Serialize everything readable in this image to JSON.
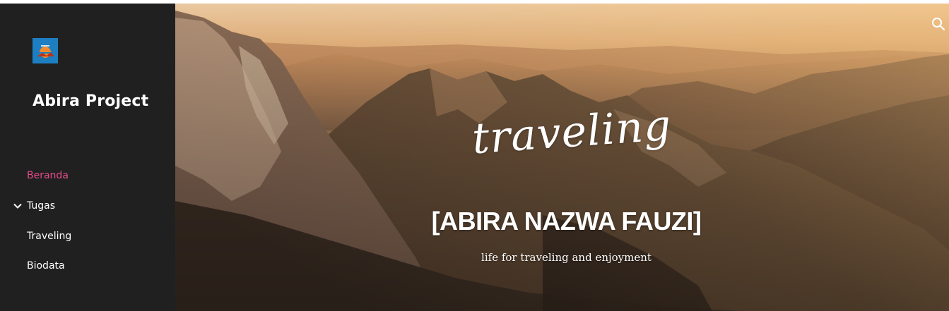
{
  "site": {
    "title": "Abira Project",
    "logo_icon": "sunset-logo-icon",
    "accent_color": "#e64c8c",
    "sidebar_color": "#202020"
  },
  "nav": {
    "items": [
      {
        "label": "Beranda",
        "active": true
      },
      {
        "label": "Tugas",
        "expandable": true,
        "icon": "chevron-down-icon"
      },
      {
        "label": "Traveling"
      },
      {
        "label": "Biodata"
      }
    ]
  },
  "hero": {
    "script_title": "traveling",
    "heading": "[ABIRA NAZWA FAUZI]",
    "subtitle": "life for traveling and enjoyment",
    "search_icon": "search-icon"
  }
}
